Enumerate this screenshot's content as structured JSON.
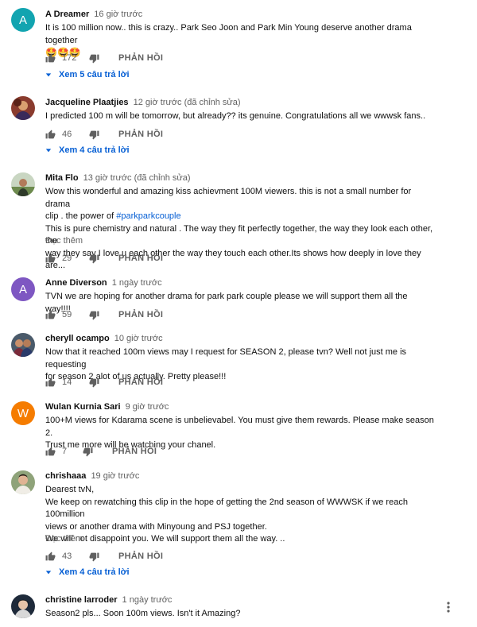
{
  "labels": {
    "reply": "PHẢN HỒI",
    "read_more": "Đọc thêm"
  },
  "colors": {
    "link_blue": "#065fd4",
    "secondary_text": "#606060",
    "avatar_teal": "#12a4b0",
    "avatar_purple": "#7e57c2",
    "avatar_orange": "#f57c00"
  },
  "comments": [
    {
      "author": "A Dreamer",
      "time": "16 giờ trước",
      "avatar_letter": "A",
      "lines": [
        "It is 100 million now.. this is crazy.. Park Seo Joon and Park Min Young deserve another drama together"
      ],
      "emoji": "🤩🤩🤩",
      "likes": "172",
      "replies": "Xem 5 câu trả lời"
    },
    {
      "author": "Jacqueline Plaatjies",
      "time": "12 giờ trước (đã chỉnh sửa)",
      "lines": [
        "I predicted 100 m will be tomorrow, but already?? its genuine. Congratulations all we wwwsk fans.."
      ],
      "likes": "46",
      "replies": "Xem 4 câu trả lời"
    },
    {
      "author": "Mita Flo",
      "time": "13 giờ trước (đã chỉnh sửa)",
      "lines": [
        "Wow this wonderful and amazing kiss achievment 100M viewers. this is not a small number for drama",
        "clip . the power of",
        "This is pure chemistry and natural . The way they fit perfectly together, the way they look each other, the",
        "way they say I love u each other the way they touch each other.Its shows how deeply in love they are..."
      ],
      "hashtag": "#parkparkcouple",
      "likes": "29"
    },
    {
      "author": "Anne Diverson",
      "time": "1 ngày trước",
      "avatar_letter": "A",
      "lines": [
        "TVN we are hoping for another drama for park park couple please we will support them all the way!!!!"
      ],
      "likes": "59"
    },
    {
      "author": "cheryll ocampo",
      "time": "10 giờ trước",
      "lines": [
        "Now that it reached 100m views may I request for SEASON 2, please tvn? Well not just me is requesting",
        "for season 2 alot of us actually. Pretty please!!!"
      ],
      "likes": "14"
    },
    {
      "author": "Wulan Kurnia Sari",
      "time": "9 giờ trước",
      "avatar_letter": "W",
      "lines": [
        "100+M views for Kdarama scene is  unbelievabel. You must give them rewards. Please make season 2.",
        "Trust me more will be watching your chanel."
      ],
      "likes": "7"
    },
    {
      "author": "chrishaaa",
      "time": "19 giờ trước",
      "lines": [
        "Dearest tvN,",
        "We keep on rewatching this clip in the hope of getting the 2nd season of WWWSK if we reach 100million",
        "views or another drama with Minyoung and PSJ together.",
        "We will not disappoint you. We will support them all the way. .."
      ],
      "likes": "43",
      "replies": "Xem 4 câu trả lời"
    },
    {
      "author": "christine larroder",
      "time": "1 ngày trước",
      "lines": [
        "Season2 pls... Soon 100m views. Isn't it Amazing?"
      ]
    }
  ]
}
